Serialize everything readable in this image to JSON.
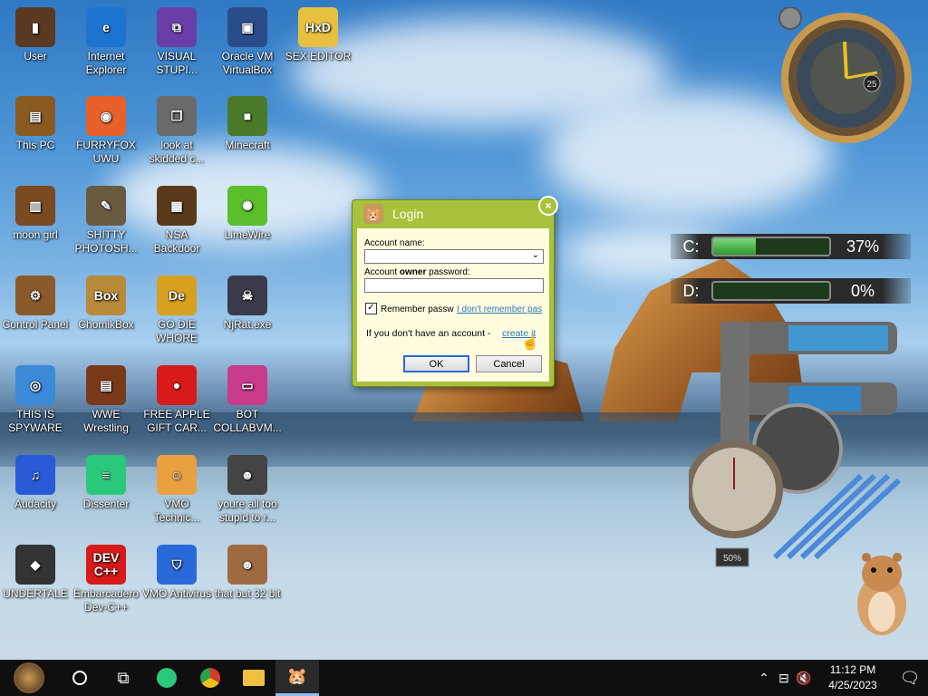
{
  "desktop_icons": [
    {
      "label": "User",
      "glyph": "▮",
      "color": "#5a3a22"
    },
    {
      "label": "Internet Explorer",
      "glyph": "e",
      "color": "#1d74d0"
    },
    {
      "label": "VISUAL STUPI...",
      "glyph": "⧉",
      "color": "#6a3ea8"
    },
    {
      "label": "Oracle VM VirtualBox",
      "glyph": "▣",
      "color": "#2a4d8a"
    },
    {
      "label": "SEX EDITOR",
      "glyph": "HxD",
      "color": "#e8c040"
    },
    {
      "label": "This PC",
      "glyph": "▤",
      "color": "#8a5a20"
    },
    {
      "label": "FURRYFOX UWU",
      "glyph": "◉",
      "color": "#e8602a"
    },
    {
      "label": "look at skidded c...",
      "glyph": "❐",
      "color": "#6a6a6a"
    },
    {
      "label": "Minecraft",
      "glyph": "■",
      "color": "#4a7a2a"
    },
    {
      "label": "moon girl",
      "glyph": "▥",
      "color": "#7a4a20"
    },
    {
      "label": "SHITTY PHOTOSH...",
      "glyph": "✎",
      "color": "#6a5a40"
    },
    {
      "label": "NSA Backdoor",
      "glyph": "▦",
      "color": "#5a3a1a"
    },
    {
      "label": "LimeWire",
      "glyph": "✺",
      "color": "#5abf2a"
    },
    {
      "label": "Control Panel",
      "glyph": "⚙",
      "color": "#8a5a2a"
    },
    {
      "label": "ChomikBox",
      "glyph": "Box",
      "color": "#b88a3a"
    },
    {
      "label": "GO DIE WHORE",
      "glyph": "De",
      "color": "#d8a020"
    },
    {
      "label": "NjRat.exe",
      "glyph": "☠",
      "color": "#3a3a4a"
    },
    {
      "label": "THIS IS SPYWARE",
      "glyph": "◎",
      "color": "#3a8ad8"
    },
    {
      "label": "WWE Wrestling",
      "glyph": "▤",
      "color": "#7a3a1a"
    },
    {
      "label": "FREE APPLE GIFT CAR...",
      "glyph": "●",
      "color": "#d81a1a"
    },
    {
      "label": "BOT COLLABVM...",
      "glyph": "▭",
      "color": "#c83a8a"
    },
    {
      "label": "Audacity",
      "glyph": "♫",
      "color": "#2a5ad8"
    },
    {
      "label": "Dissenter",
      "glyph": "≡",
      "color": "#2ac87a"
    },
    {
      "label": "VMO Technic...",
      "glyph": "☺",
      "color": "#e8a040"
    },
    {
      "label": "youre all too stupid to r...",
      "glyph": "☻",
      "color": "#444"
    },
    {
      "label": "UNDERTALE",
      "glyph": "◆",
      "color": "#333"
    },
    {
      "label": "Embarcadero Dev-C++",
      "glyph": "DEV C++",
      "color": "#d81a1a"
    },
    {
      "label": "VMO Antivirus",
      "glyph": "⛉",
      "color": "#2a6ad8"
    },
    {
      "label": "that but 32 bit",
      "glyph": "☻",
      "color": "#a06a40"
    }
  ],
  "login_dialog": {
    "title": "Login",
    "account_label": "Account name:",
    "password_label_pre": "Account ",
    "password_label_bold": "owner",
    "password_label_post": " password:",
    "remember_label": "Remember passw",
    "remember_checked": true,
    "forgot_link": "I don't remember pas",
    "no_account_text": "If you don't have an account - ",
    "create_link": "create it",
    "ok_label": "OK",
    "cancel_label": "Cancel"
  },
  "drives": [
    {
      "letter": "C:",
      "percent": "37%",
      "used_fraction": 0.37
    },
    {
      "letter": "D:",
      "percent": "0%",
      "used_fraction": 0.0
    }
  ],
  "clock_gadget": {
    "date_number": "25"
  },
  "pipe_gauge": {
    "label": "50%"
  },
  "taskbar": {
    "time": "11:12 PM",
    "date": "4/25/2023"
  }
}
